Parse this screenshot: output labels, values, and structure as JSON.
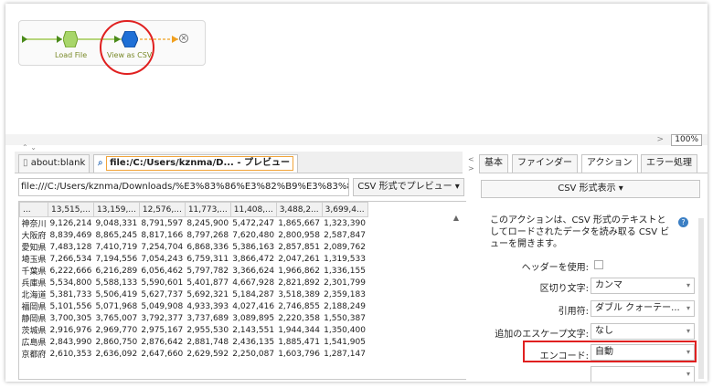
{
  "flow": {
    "node1_label": "Load File",
    "node2_label": "View as CSV"
  },
  "zoom": "100%",
  "browser": {
    "tabs": [
      {
        "label": "about:blank"
      },
      {
        "label": "file:/C:/Users/kznma/D... - プレビュー"
      }
    ],
    "url": "file:///C:/Users/kznma/Downloads/%E3%83%86%E3%82%B9%E3%83%88CSV",
    "preview_button": "CSV 形式でプレビュー ▾"
  },
  "grid": {
    "headers": [
      "...",
      "13,515,...",
      "13,159,...",
      "12,576,...",
      "11,773,...",
      "11,408,...",
      "3,488,2...",
      "3,699,4..."
    ],
    "rows": [
      [
        "神奈川",
        "9,126,214",
        "9,048,331",
        "8,791,597",
        "8,245,900",
        "5,472,247",
        "1,865,667",
        "1,323,390"
      ],
      [
        "大阪府",
        "8,839,469",
        "8,865,245",
        "8,817,166",
        "8,797,268",
        "7,620,480",
        "2,800,958",
        "2,587,847"
      ],
      [
        "愛知県",
        "7,483,128",
        "7,410,719",
        "7,254,704",
        "6,868,336",
        "5,386,163",
        "2,857,851",
        "2,089,762"
      ],
      [
        "埼玉県",
        "7,266,534",
        "7,194,556",
        "7,054,243",
        "6,759,311",
        "3,866,472",
        "2,047,261",
        "1,319,533"
      ],
      [
        "千葉県",
        "6,222,666",
        "6,216,289",
        "6,056,462",
        "5,797,782",
        "3,366,624",
        "1,966,862",
        "1,336,155"
      ],
      [
        "兵庫県",
        "5,534,800",
        "5,588,133",
        "5,590,601",
        "5,401,877",
        "4,667,928",
        "2,821,892",
        "2,301,799"
      ],
      [
        "北海道",
        "5,381,733",
        "5,506,419",
        "5,627,737",
        "5,692,321",
        "5,184,287",
        "3,518,389",
        "2,359,183"
      ],
      [
        "福岡県",
        "5,101,556",
        "5,071,968",
        "5,049,908",
        "4,933,393",
        "4,027,416",
        "2,746,855",
        "2,188,249"
      ],
      [
        "静岡県",
        "3,700,305",
        "3,765,007",
        "3,792,377",
        "3,737,689",
        "3,089,895",
        "2,220,358",
        "1,550,387"
      ],
      [
        "茨城県",
        "2,916,976",
        "2,969,770",
        "2,975,167",
        "2,955,530",
        "2,143,551",
        "1,944,344",
        "1,350,400"
      ],
      [
        "広島県",
        "2,843,990",
        "2,860,750",
        "2,876,642",
        "2,881,748",
        "2,436,135",
        "1,885,471",
        "1,541,905"
      ],
      [
        "京都府",
        "2,610,353",
        "2,636,092",
        "2,647,660",
        "2,629,592",
        "2,250,087",
        "1,603,796",
        "1,287,147"
      ]
    ]
  },
  "right_panel": {
    "tabs": [
      "基本",
      "ファインダー",
      "アクション",
      "エラー処理"
    ],
    "active_tab": "アクション",
    "csv_button": "CSV 形式表示 ▾",
    "description": "このアクションは、CSV 形式のテキストとしてロードされたデータを読み取る CSV ビューを開きます。",
    "header_label": "ヘッダーを使用:",
    "delimiter_label": "区切り文字:",
    "delimiter_value": "カンマ",
    "quote_label": "引用符:",
    "quote_value": "ダブル クォーテー...",
    "escape_label": "追加のエスケープ文字:",
    "escape_value": "なし",
    "encode_label": "エンコード:",
    "encode_value": "自動"
  }
}
